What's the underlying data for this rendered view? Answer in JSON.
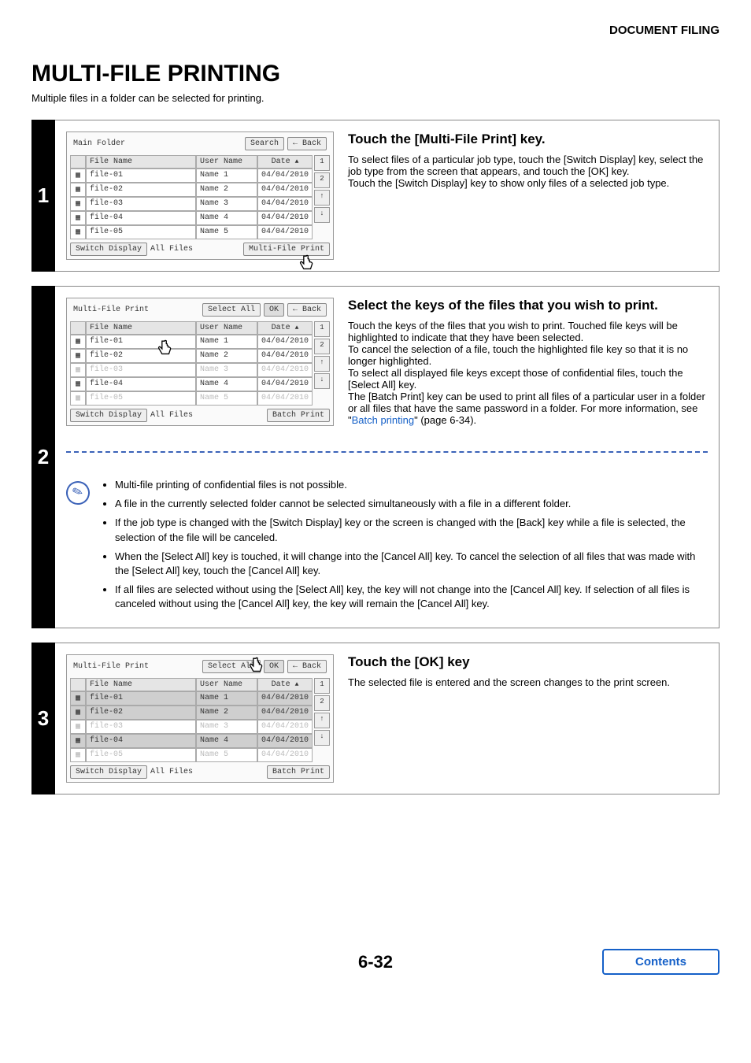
{
  "header": {
    "section": "DOCUMENT FILING"
  },
  "title": "MULTI-FILE PRINTING",
  "subtitle": "Multiple files in a folder can be selected for printing.",
  "pageNumber": "6-32",
  "contentsLabel": "Contents",
  "panelCommon": {
    "cols": {
      "fileName": "File Name",
      "userName": "User Name",
      "date": "Date"
    },
    "search": "Search",
    "back": "Back",
    "ok": "OK",
    "selectAll": "Select All",
    "switchDisplay": "Switch Display",
    "allFiles": "All Files",
    "multiFilePrint": "Multi-File Print",
    "batchPrint": "Batch Print",
    "pageIndicator": {
      "cur": "1",
      "total": "2"
    }
  },
  "files": [
    {
      "name": "file-01",
      "user": "Name 1",
      "date": "04/04/2010"
    },
    {
      "name": "file-02",
      "user": "Name 2",
      "date": "04/04/2010"
    },
    {
      "name": "file-03",
      "user": "Name 3",
      "date": "04/04/2010"
    },
    {
      "name": "file-04",
      "user": "Name 4",
      "date": "04/04/2010"
    },
    {
      "name": "file-05",
      "user": "Name 5",
      "date": "04/04/2010"
    }
  ],
  "step1": {
    "num": "1",
    "panelTitle": "Main Folder",
    "heading": "Touch the [Multi-File Print] key.",
    "body1": "To select files of a particular job type, touch the [Switch Display] key, select the job type from the screen that appears, and touch the [OK] key.",
    "body2": "Touch the [Switch Display] key to show only files of a selected job type."
  },
  "step2": {
    "num": "2",
    "panelTitle": "Multi-File Print",
    "heading": "Select the keys of the files that you wish to print.",
    "body1": "Touch the keys of the files that you wish to print. Touched file keys will be highlighted to indicate that they have been selected.",
    "body2": "To cancel the selection of a file, touch the highlighted file key so that it is no longer highlighted.",
    "body3": "To select all displayed file keys except those of confidential files, touch the [Select All] key.",
    "body4a": "The [Batch Print] key can be used to print all files of a particular user in a folder or all files that have the same password in a folder. For more information, see \"",
    "body4link": "Batch printing",
    "body4b": "\" (page 6-34).",
    "notes": [
      "Multi-file printing of confidential files is not possible.",
      "A file in the currently selected folder cannot be selected simultaneously with a file in a different folder.",
      "If the job type is changed with the [Switch Display] key or the screen is changed with the [Back] key while a file is selected, the selection of the file will be canceled.",
      "When the [Select All] key is touched, it will change into the [Cancel All] key. To cancel the selection of all files that was made with the [Select All] key, touch the [Cancel All] key.",
      "If all files are selected without using the [Select All] key, the key will not change into the [Cancel All] key. If selection of all files is canceled without using the [Cancel All] key, the key will remain the [Cancel All] key."
    ]
  },
  "step3": {
    "num": "3",
    "panelTitle": "Multi-File Print",
    "heading": "Touch the [OK] key",
    "body": "The selected file is entered and the screen changes to the print screen."
  }
}
